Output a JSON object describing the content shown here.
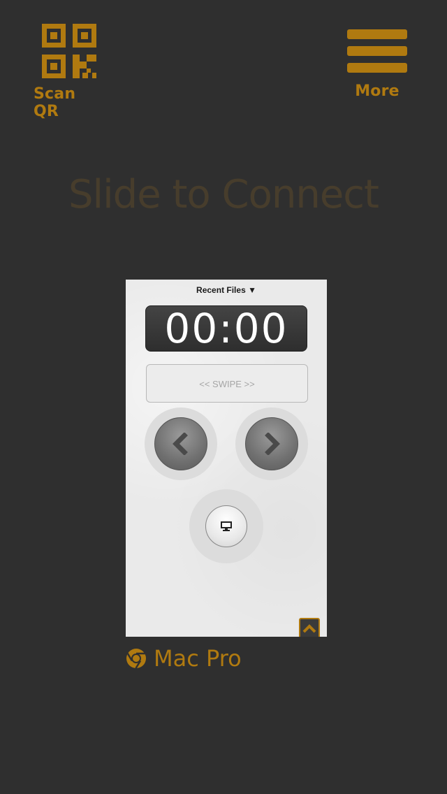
{
  "header": {
    "scan_label": "Scan QR",
    "more_label": "More",
    "scan_icon": "qr-code-icon",
    "more_icon": "hamburger-menu-icon"
  },
  "main": {
    "slide_text": "Slide to Connect"
  },
  "preview": {
    "recent_files_label": "Recent Files ▼",
    "timer": "00:00",
    "swipe_label": "<< SWIPE >>",
    "prev_icon": "chevron-left-icon",
    "next_icon": "chevron-right-icon",
    "screen_icon": "monitor-icon",
    "up_icon": "chevron-up-icon"
  },
  "device": {
    "name": "Mac Pro",
    "icon": "chrome-icon"
  },
  "colors": {
    "background": "#2f2f2f",
    "accent": "#b07a10",
    "slide_text": "#4a3f2c"
  }
}
